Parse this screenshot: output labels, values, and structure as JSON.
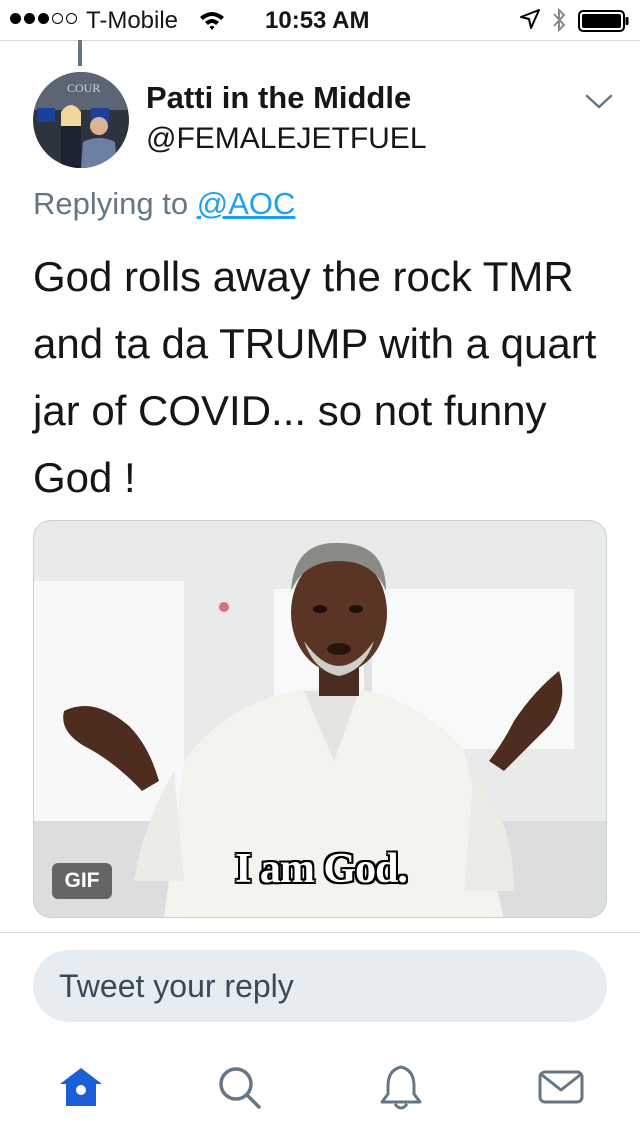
{
  "status_bar": {
    "carrier": "T-Mobile",
    "time": "10:53 AM",
    "signal_bars_filled": 3,
    "signal_bars_total": 5
  },
  "tweet": {
    "display_name": "Patti in the Middle",
    "handle": "@FEMALEJETFUEL",
    "replying_prefix": "Replying to ",
    "replying_to": "@AOC",
    "text": "God rolls away the rock TMR and ta da TRUMP with a quart jar of COVID... so not funny God !",
    "media": {
      "badge": "GIF",
      "caption": "I am God."
    }
  },
  "reply_box": {
    "placeholder": "Tweet your reply"
  },
  "tab_bar": {
    "items": [
      "home-icon",
      "search-icon",
      "notifications-icon",
      "messages-icon"
    ],
    "active": "home-icon"
  },
  "colors": {
    "accent": "#1da1f2",
    "home_active": "#1b5fd6",
    "secondary_text": "#657786",
    "icon_gray": "#657786",
    "reply_box_bg": "#e6ecf0"
  }
}
